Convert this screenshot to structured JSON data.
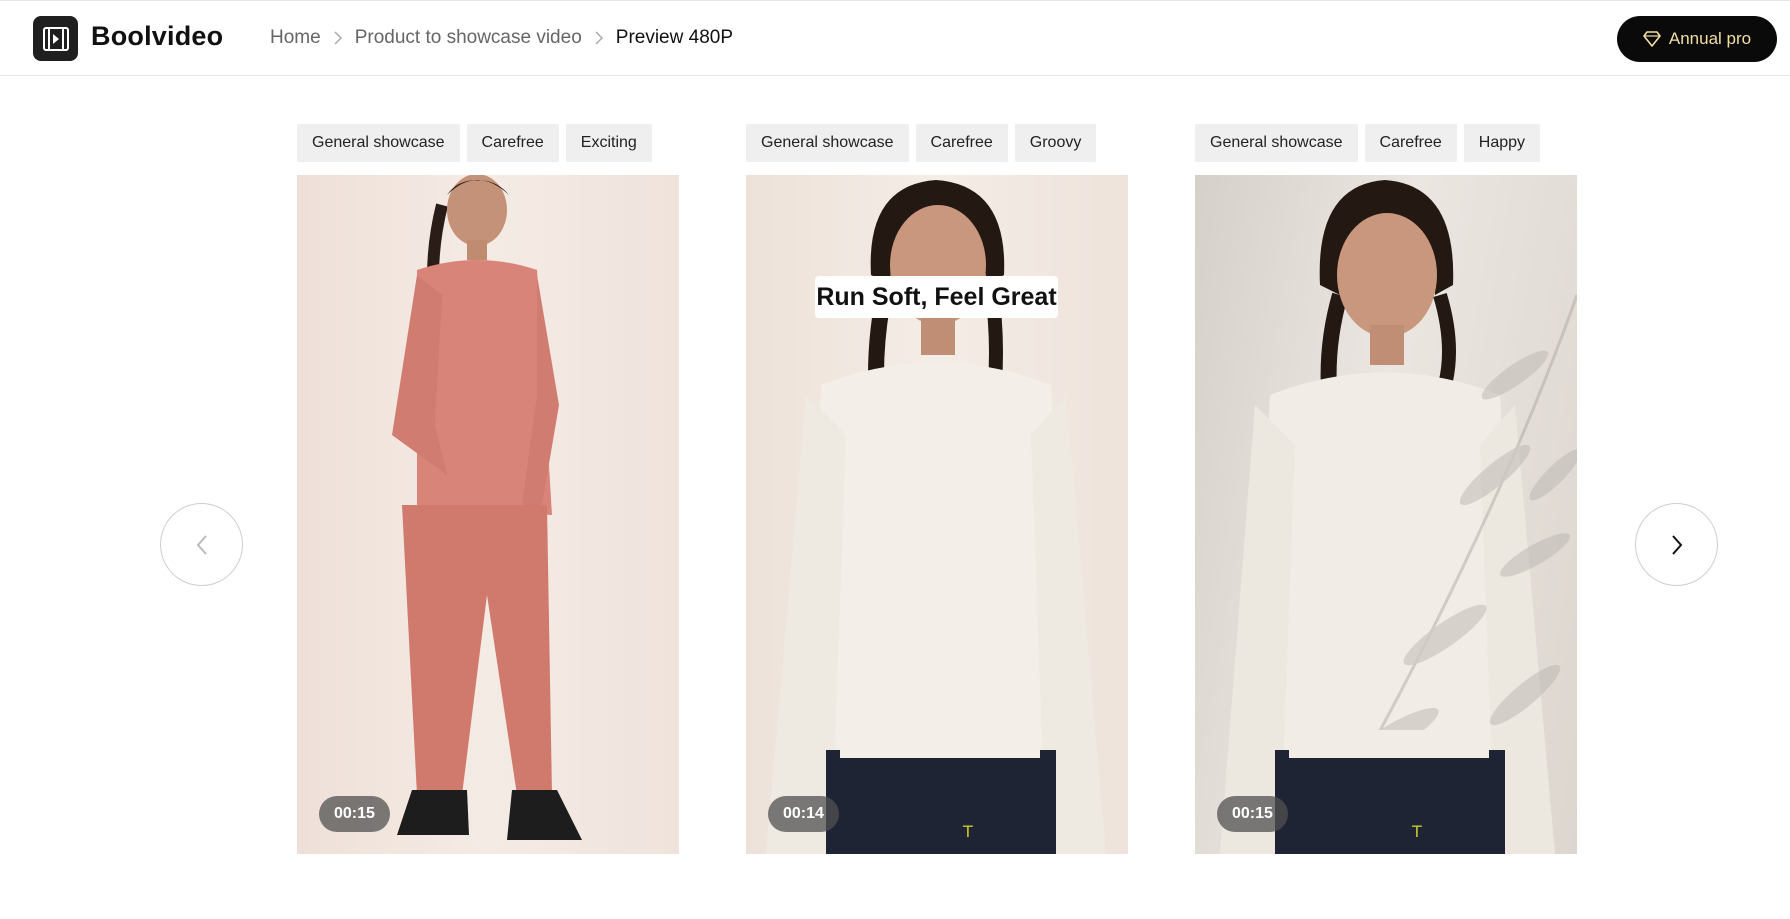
{
  "brand": {
    "name": "Boolvideo"
  },
  "breadcrumb": {
    "items": [
      "Home",
      "Product to showcase video",
      "Preview 480P"
    ]
  },
  "header": {
    "pro_label": "Annual pro"
  },
  "colors": {
    "accent_gold": "#f3dfa3",
    "button_dark": "#0a0a0a",
    "tag_bg": "#efefef"
  },
  "cards": [
    {
      "tags": [
        "General showcase",
        "Carefree",
        "Exciting"
      ],
      "duration": "00:15",
      "caption": ""
    },
    {
      "tags": [
        "General showcase",
        "Carefree",
        "Groovy"
      ],
      "duration": "00:14",
      "caption": "Run Soft, Feel Great"
    },
    {
      "tags": [
        "General showcase",
        "Carefree",
        "Happy"
      ],
      "duration": "00:15",
      "caption": ""
    }
  ],
  "icons": {
    "logo": "video-frame-icon",
    "pro": "diamond-icon",
    "prev": "chevron-left-icon",
    "next": "chevron-right-icon",
    "separator": "chevron-right-icon"
  }
}
